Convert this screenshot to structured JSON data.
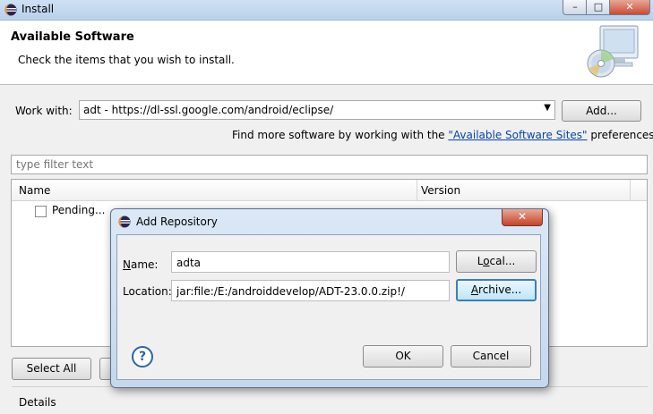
{
  "window": {
    "title": "Install",
    "minimize_label": "–",
    "maximize_label": "□",
    "close_label": "✕"
  },
  "header": {
    "title": "Available Software",
    "subtitle": "Check the items that you wish to install."
  },
  "work_with": {
    "label": "Work with:",
    "value": "adt - https://dl-ssl.google.com/android/eclipse/",
    "add_button": "Add..."
  },
  "find_more": {
    "prefix": "Find more software by working with the ",
    "link": "\"Available Software Sites\"",
    "suffix": " preferences."
  },
  "filter": {
    "placeholder": "type filter text"
  },
  "tree": {
    "columns": [
      "Name",
      "Version"
    ],
    "rows": [
      {
        "label": "Pending...",
        "checked": false
      }
    ]
  },
  "buttons": {
    "select_all": "Select All"
  },
  "details_label": "Details",
  "dialog": {
    "title": "Add Repository",
    "close_label": "✕",
    "name_label_first": "N",
    "name_label_rest": "ame:",
    "name_value": "adta",
    "local_button_pre": "L",
    "local_button_u": "o",
    "local_button_post": "cal...",
    "location_label_pre": "Location:",
    "location_value": "jar:file:/E:/androiddevelop/ADT-23.0.0.zip!/",
    "archive_button_u": "A",
    "archive_button_rest": "rchive...",
    "help_label": "?",
    "ok_button": "OK",
    "cancel_button": "Cancel"
  }
}
